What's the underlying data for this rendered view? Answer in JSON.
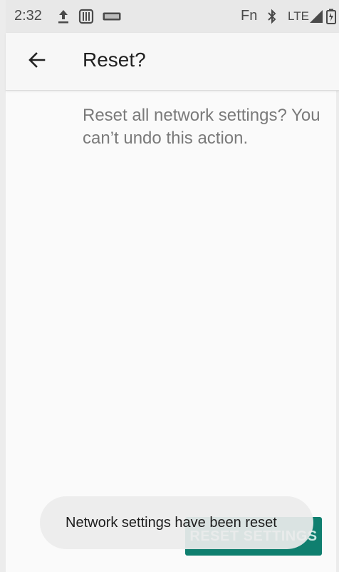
{
  "status_bar": {
    "time": "2:32",
    "fn_label": "Fn",
    "network_label": "LTE",
    "icons": [
      "upload-icon",
      "sim-card-icon",
      "volte-icon",
      "bluetooth-icon",
      "signal-icon",
      "battery-icon"
    ]
  },
  "app_bar": {
    "title": "Reset?",
    "back_icon": "arrow-back-icon"
  },
  "content": {
    "message": "Reset all network settings? You can’t undo this action."
  },
  "actions": {
    "reset_label": "RESET SETTINGS"
  },
  "toast": {
    "text": "Network settings have been reset"
  },
  "colors": {
    "accent": "#0f7f6f",
    "background": "#fafafa",
    "status_bar": "#e8e8e8"
  }
}
